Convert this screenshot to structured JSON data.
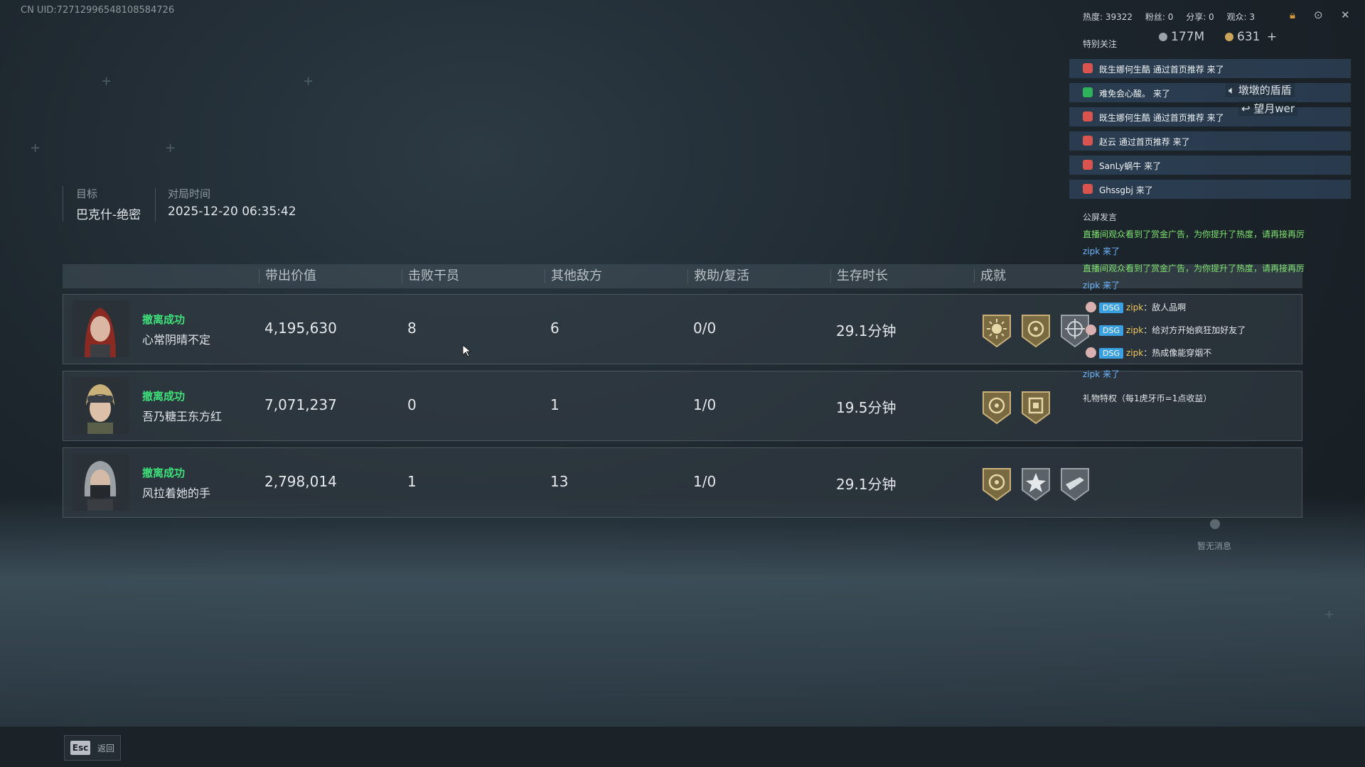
{
  "uid": "CN UID:7271299654810858​4726",
  "match_info": {
    "target_label": "目标",
    "target_value": "巴克什-绝密",
    "time_label": "对局时间",
    "time_value": "2025-12-20 06:35:42"
  },
  "table": {
    "headers": [
      "带出价值",
      "击败干员",
      "其他敌方",
      "救助/复活",
      "生存时长",
      "成就"
    ],
    "rows": [
      {
        "status": "撤离成功",
        "name": "心常阴晴不定",
        "value": "4,195,630",
        "kills": "8",
        "others": "6",
        "assist": "0/0",
        "survival": "29.1分钟"
      },
      {
        "status": "撤离成功",
        "name": "吾乃糖王东方红",
        "value": "7,071,237",
        "kills": "0",
        "others": "1",
        "assist": "1/0",
        "survival": "19.5分钟"
      },
      {
        "status": "撤离成功",
        "name": "风拉着她的手",
        "value": "2,798,014",
        "kills": "1",
        "others": "13",
        "assist": "1/0",
        "survival": "29.1分钟"
      }
    ]
  },
  "footer": {
    "esc_key": "Esc",
    "back_label": "返回"
  },
  "overlay": {
    "stats": {
      "heat": "热度: 39322",
      "fans": "粉丝: 0",
      "share": "分享: 0",
      "viewers": "观众: 3"
    },
    "special_label": "特别关注",
    "currency_silver": "177M",
    "currency_gold": "631",
    "currency_plus": "+",
    "notifications": [
      {
        "text": "既生娜何生酷 通过首页推荐 来了",
        "icon_color": "#d9534f"
      },
      {
        "text": "难免会心酸。 来了",
        "icon_color": "#2fb35a"
      },
      {
        "text": "既生娜何生酷 通过首页推荐 来了",
        "icon_color": "#d9534f"
      },
      {
        "text": "赵云 通过首页推荐 来了",
        "icon_color": "#d9534f"
      },
      {
        "text": "SanLy蜗牛 来了",
        "icon_color": "#d9534f"
      },
      {
        "text": "Ghssgbj 来了",
        "icon_color": "#d9534f"
      }
    ],
    "floaters": [
      "墩墩的盾盾",
      "望月wer"
    ],
    "chat_label": "公屏发言",
    "chat": {
      "ad1": "直播间观众看到了赏金广告，为你提升了热度，请再接再厉",
      "join1": "zipk 来了",
      "ad2": "直播间观众看到了赏金广告，为你提升了热度，请再接再厉",
      "join2": "zipk 来了",
      "badge": "DSG",
      "user": "zipk",
      "msg1": "：敌人品啊",
      "msg2": "：给对方开始疯狂加好友了",
      "msg3": "：热成像能穿烟不",
      "join3": "zipk 来了"
    },
    "gift_privilege": "礼物特权（每1虎牙币=1点收益）",
    "no_message": "暂无消息"
  }
}
